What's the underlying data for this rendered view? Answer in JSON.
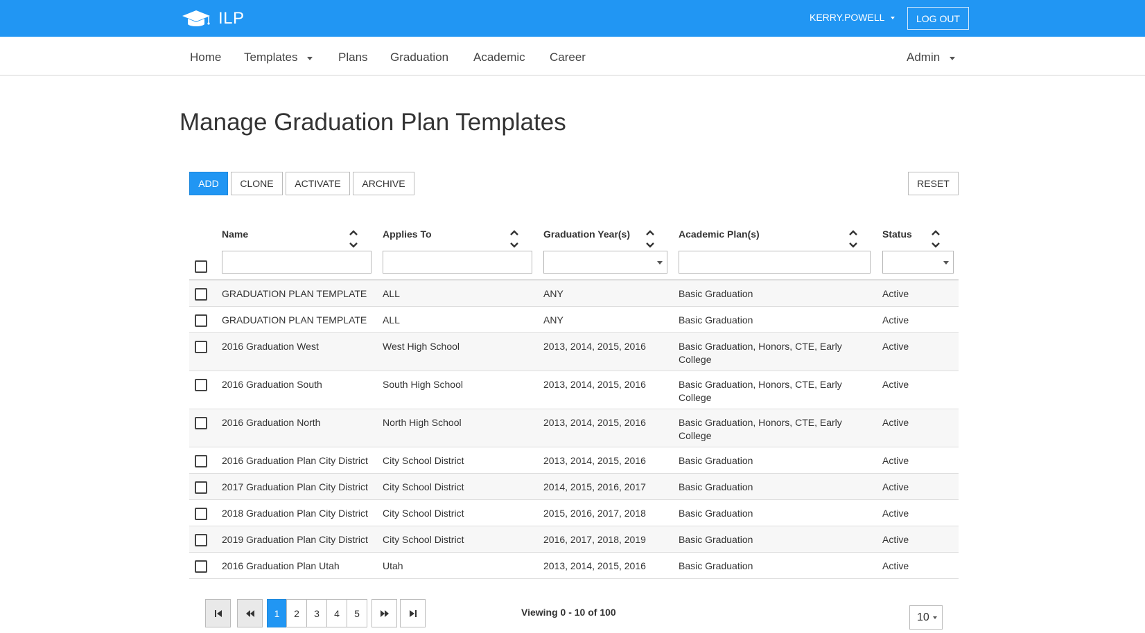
{
  "app": {
    "title": "ILP"
  },
  "user": {
    "name": "KERRY.POWELL",
    "logout_label": "LOG OUT"
  },
  "nav": {
    "items": [
      "Home",
      "Templates",
      "Plans",
      "Graduation",
      "Academic",
      "Career"
    ],
    "admin": "Admin"
  },
  "page": {
    "title": "Manage Graduation Plan Templates"
  },
  "toolbar": {
    "add": "ADD",
    "clone": "CLONE",
    "activate": "ACTIVATE",
    "archive": "ARCHIVE",
    "reset": "RESET"
  },
  "table": {
    "columns": [
      "Name",
      "Applies To",
      "Graduation Year(s)",
      "Academic Plan(s)",
      "Status"
    ],
    "rows": [
      {
        "name": "GRADUATION PLAN TEMPLATE",
        "applies_to": "ALL",
        "years": "ANY",
        "plans": "Basic Graduation",
        "status": "Active"
      },
      {
        "name": "GRADUATION PLAN TEMPLATE",
        "applies_to": "ALL",
        "years": "ANY",
        "plans": "Basic Graduation",
        "status": "Active"
      },
      {
        "name": "2016 Graduation West",
        "applies_to": "West High School",
        "years": "2013, 2014, 2015, 2016",
        "plans": "Basic Graduation, Honors, CTE, Early College",
        "status": "Active"
      },
      {
        "name": "2016 Graduation South",
        "applies_to": "South High School",
        "years": "2013, 2014, 2015, 2016",
        "plans": "Basic Graduation, Honors, CTE, Early College",
        "status": "Active"
      },
      {
        "name": "2016 Graduation North",
        "applies_to": "North High School",
        "years": "2013, 2014, 2015, 2016",
        "plans": "Basic Graduation, Honors, CTE, Early College",
        "status": "Active"
      },
      {
        "name": "2016 Graduation Plan City District",
        "applies_to": "City School District",
        "years": "2013, 2014, 2015, 2016",
        "plans": "Basic Graduation",
        "status": "Active"
      },
      {
        "name": "2017 Graduation Plan City District",
        "applies_to": "City School District",
        "years": "2014, 2015, 2016, 2017",
        "plans": "Basic Graduation",
        "status": "Active"
      },
      {
        "name": "2018 Graduation Plan City District",
        "applies_to": "City School District",
        "years": "2015, 2016, 2017, 2018",
        "plans": "Basic Graduation",
        "status": "Active"
      },
      {
        "name": "2019 Graduation Plan City District",
        "applies_to": "City School District",
        "years": "2016, 2017, 2018, 2019",
        "plans": "Basic Graduation",
        "status": "Active"
      },
      {
        "name": "2016 Graduation Plan Utah",
        "applies_to": "Utah",
        "years": "2013, 2014, 2015, 2016",
        "plans": "Basic Graduation",
        "status": "Active"
      }
    ]
  },
  "pagination": {
    "pages": [
      "1",
      "2",
      "3",
      "4",
      "5"
    ],
    "current_page": "1",
    "viewing": "Viewing 0 - 10 of 100",
    "page_size": "10"
  },
  "colors": {
    "primary": "#2196f3"
  }
}
